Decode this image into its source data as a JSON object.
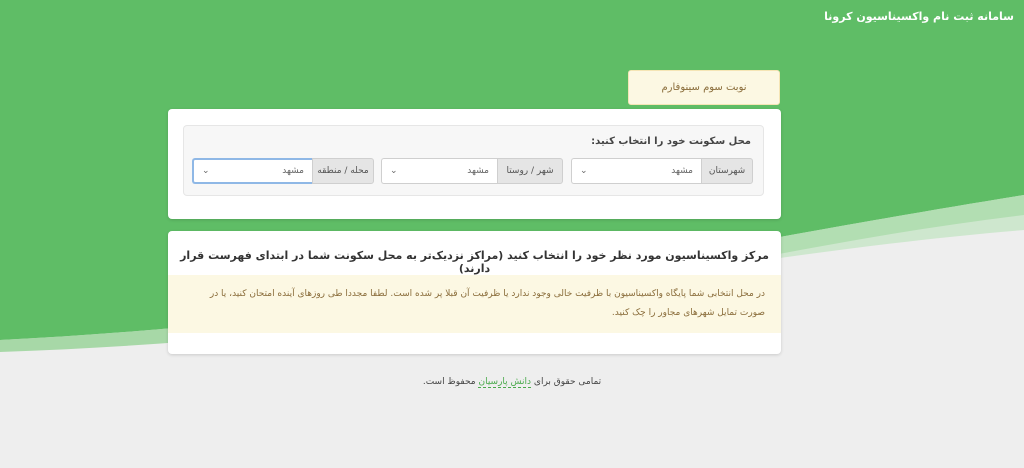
{
  "header": {
    "site_title": "سامانه ثبت نام واکسیناسیون کرونا"
  },
  "notice": {
    "label": "نوبت سوم سینوفارم"
  },
  "location": {
    "label": "محل سکونت خود را انتخاب کنید:",
    "fields": [
      {
        "addon": "شهرستان",
        "value": "مشهد"
      },
      {
        "addon": "شهر / روستا",
        "value": "مشهد"
      },
      {
        "addon": "محله / منطقه",
        "value": "مشهد"
      }
    ]
  },
  "centers": {
    "title": "مرکز واکسیناسیون مورد نظر خود را انتخاب کنید (مراکز نزدیک‌تر به محل سکونت شما در ابتدای فهرست قرار دارند)",
    "warning": "در محل انتخابی شما پایگاه واکسیناسیون با ظرفیت خالی وجود ندارد یا ظرفیت آن قبلا پر شده است. لطفا مجددا طی روزهای آینده امتحان کنید، یا در صورت تمایل شهرهای مجاور را چک کنید."
  },
  "footer": {
    "prefix": "تمامی حقوق برای",
    "link": "دانش پارسیان",
    "suffix": "محفوظ است."
  },
  "colors": {
    "header_green": "#5cb85c",
    "warning_bg": "#fcf8e3",
    "warning_text": "#8a6d3b"
  }
}
